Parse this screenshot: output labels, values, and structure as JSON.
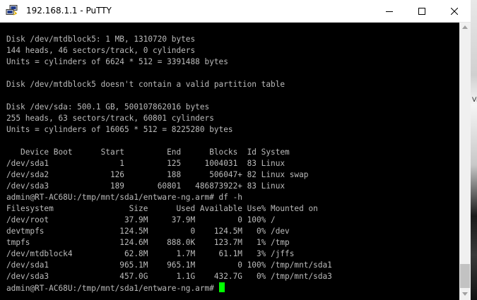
{
  "window": {
    "title": "192.168.1.1 - PuTTY",
    "app_icon": "putty-computers-icon",
    "controls": {
      "minimize_icon": "minimize-icon",
      "maximize_icon": "maximize-icon",
      "close_icon": "close-icon"
    }
  },
  "desktop": {
    "partial_text": "Vif"
  },
  "terminal": {
    "cursor_color": "#00ff00",
    "text_color": "#bbbbbb",
    "background": "#000000",
    "lines": [
      "Disk /dev/mtdblock5: 1 MB, 1310720 bytes",
      "144 heads, 46 sectors/track, 0 cylinders",
      "Units = cylinders of 6624 * 512 = 3391488 bytes",
      "",
      "Disk /dev/mtdblock5 doesn't contain a valid partition table",
      "",
      "Disk /dev/sda: 500.1 GB, 500107862016 bytes",
      "255 heads, 63 sectors/track, 60801 cylinders",
      "Units = cylinders of 16065 * 512 = 8225280 bytes",
      "",
      "   Device Boot      Start         End      Blocks  Id System",
      "/dev/sda1               1         125     1004031  83 Linux",
      "/dev/sda2             126         188      506047+ 82 Linux swap",
      "/dev/sda3             189       60801   486873922+ 83 Linux",
      "admin@RT-AC68U:/tmp/mnt/sda1/entware-ng.arm# df -h",
      "Filesystem                Size      Used Available Use% Mounted on",
      "/dev/root                37.9M     37.9M         0 100% /",
      "devtmpfs                124.5M         0    124.5M   0% /dev",
      "tmpfs                   124.6M    888.0K    123.7M   1% /tmp",
      "/dev/mtdblock4           62.8M      1.7M     61.1M   3% /jffs",
      "/dev/sda1               965.1M    965.1M         0 100% /tmp/mnt/sda1",
      "/dev/sda3               457.0G      1.1G    432.7G   0% /tmp/mnt/sda3"
    ],
    "prompt": "admin@RT-AC68U:/tmp/mnt/sda1/entware-ng.arm# "
  }
}
